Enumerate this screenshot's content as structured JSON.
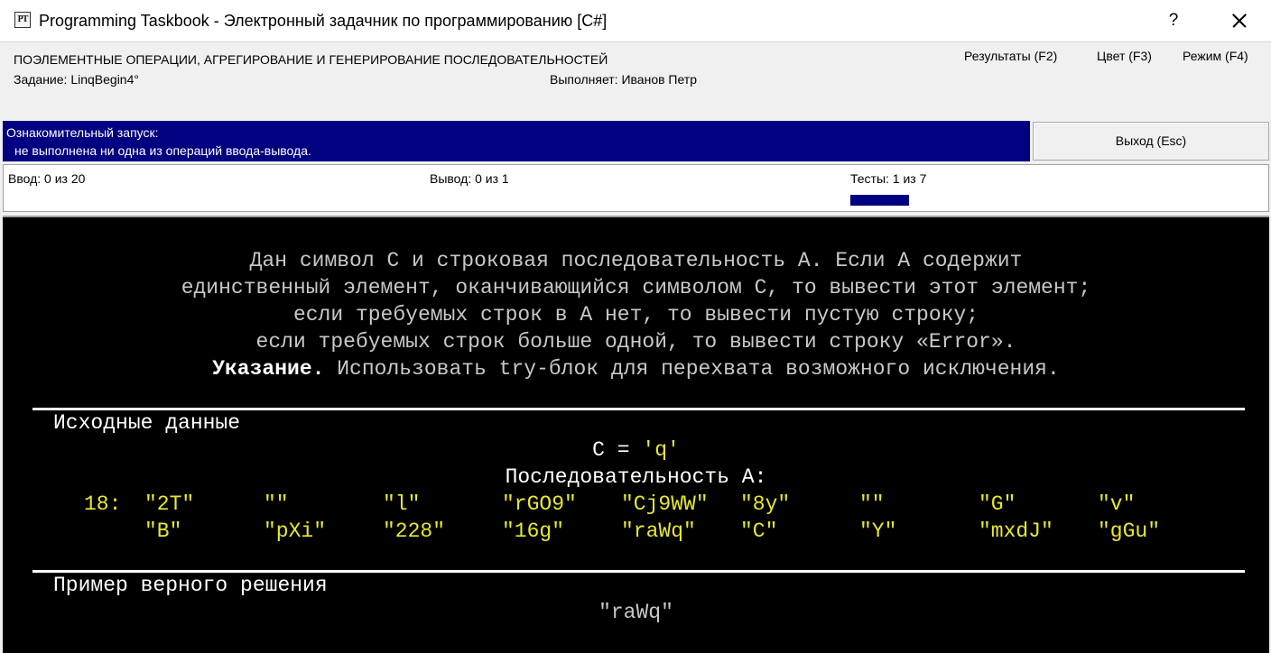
{
  "window": {
    "icon_text": "PT",
    "title": "Programming Taskbook - Электронный задачник по программированию [C#]",
    "help_label": "?"
  },
  "header": {
    "topic": "ПОЭЛЕМЕНТНЫЕ ОПЕРАЦИИ, АГРЕГИРОВАНИЕ И ГЕНЕРИРОВАНИЕ ПОСЛЕДОВАТЕЛЬНОСТЕЙ",
    "task_label": "Задание: LinqBegin4°",
    "student_label": "Выполняет: Иванов Петр",
    "menu": {
      "results": "Результаты (F2)",
      "color": "Цвет (F3)",
      "mode": "Режим (F4)"
    }
  },
  "status": {
    "line1": "Ознакомительный запуск:",
    "line2": "не выполнена ни одна из операций ввода-вывода.",
    "exit_label": "Выход (Esc)"
  },
  "progress": {
    "input": "Ввод:  0 из 20",
    "output": "Вывод:  0 из 1",
    "tests": "Тесты:  1 из 7",
    "tests_done": 1,
    "tests_total": 7
  },
  "task_text": {
    "line1": "Дан символ C и строковая последовательность A. Если A содержит",
    "line2": "единственный элемент, оканчивающийся символом C, то вывести этот элемент;",
    "line3": "если требуемых строк в A нет, то вывести пустую строку;",
    "line4": "если требуемых строк больше одной, то вывести строку «Error».",
    "hint_bold": "Указание.",
    "hint_rest": " Использовать try-блок для перехвата возможного исключения."
  },
  "input_data": {
    "heading": "Исходные данные",
    "c_prefix": "C = ",
    "c_value": "'q'",
    "sequence_label": "Последовательность A:",
    "count_label": "18:",
    "row1": [
      "\"2T\"",
      "\"\"",
      "\"l\"",
      "\"rGO9\"",
      "\"Cj9WW\"",
      "\"8y\"",
      "\"\"",
      "\"G\"",
      "\"v\""
    ],
    "row2": [
      "\"B\"",
      "\"pXi\"",
      "\"228\"",
      "\"16g\"",
      "\"raWq\"",
      "\"C\"",
      "\"Y\"",
      "\"mxdJ\"",
      "\"gGu\""
    ]
  },
  "example": {
    "heading": "Пример верного решения",
    "value": "\"raWq\""
  }
}
